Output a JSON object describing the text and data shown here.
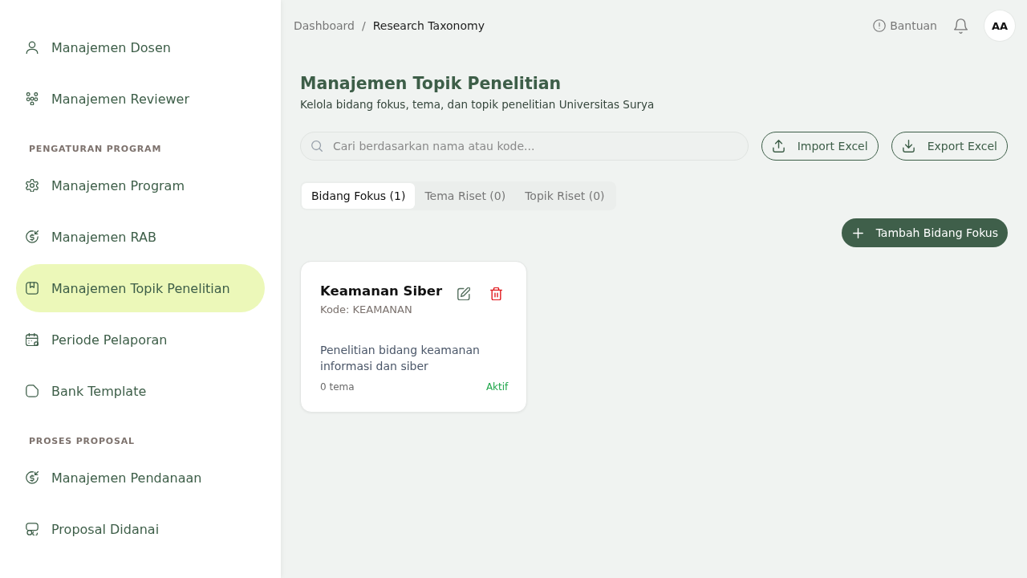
{
  "sidebar": {
    "groups": [
      {
        "items": [
          {
            "label": "Manajemen Dosen",
            "selected": false
          },
          {
            "label": "Manajemen Reviewer",
            "selected": false
          }
        ]
      },
      {
        "title": "PENGATURAN PROGRAM",
        "items": [
          {
            "label": "Manajemen Program",
            "selected": false
          },
          {
            "label": "Manajemen RAB",
            "selected": false
          },
          {
            "label": "Manajemen Topik Penelitian",
            "selected": true
          },
          {
            "label": "Periode Pelaporan",
            "selected": false
          },
          {
            "label": "Bank Template",
            "selected": false
          }
        ]
      },
      {
        "title": "PROSES PROPOSAL",
        "items": [
          {
            "label": "Manajemen Pendanaan",
            "selected": false
          },
          {
            "label": "Proposal Didanai",
            "selected": false
          }
        ]
      }
    ]
  },
  "header": {
    "breadcrumb": {
      "items": [
        {
          "label": "Dashboard",
          "current": false
        },
        {
          "label": "Research Taxonomy",
          "current": true
        }
      ],
      "separator": "/"
    },
    "help": "Bantuan",
    "avatar": "AA"
  },
  "page": {
    "title": "Manajemen Topik Penelitian",
    "subtitle": "Kelola bidang fokus, tema, dan topik penelitian Universitas Surya"
  },
  "search": {
    "placeholder": "Cari berdasarkan nama atau kode..."
  },
  "actions": [
    {
      "kind": "upload",
      "label": "Import Excel"
    },
    {
      "kind": "download",
      "label": "Export Excel"
    }
  ],
  "tabs": [
    {
      "label": "Bidang Fokus (1)",
      "selected": true
    },
    {
      "label": "Tema Riset (0)",
      "selected": false
    },
    {
      "label": "Topik Riset (0)",
      "selected": false
    }
  ],
  "add_button": {
    "label": "Tambah Bidang Fokus"
  },
  "cards": [
    {
      "title": "Keamanan Siber",
      "code": "Kode: KEAMANAN",
      "description": "Penelitian bidang keamanan informasi dan siber",
      "count": "0 tema",
      "status": "Aktif",
      "active": true
    }
  ]
}
